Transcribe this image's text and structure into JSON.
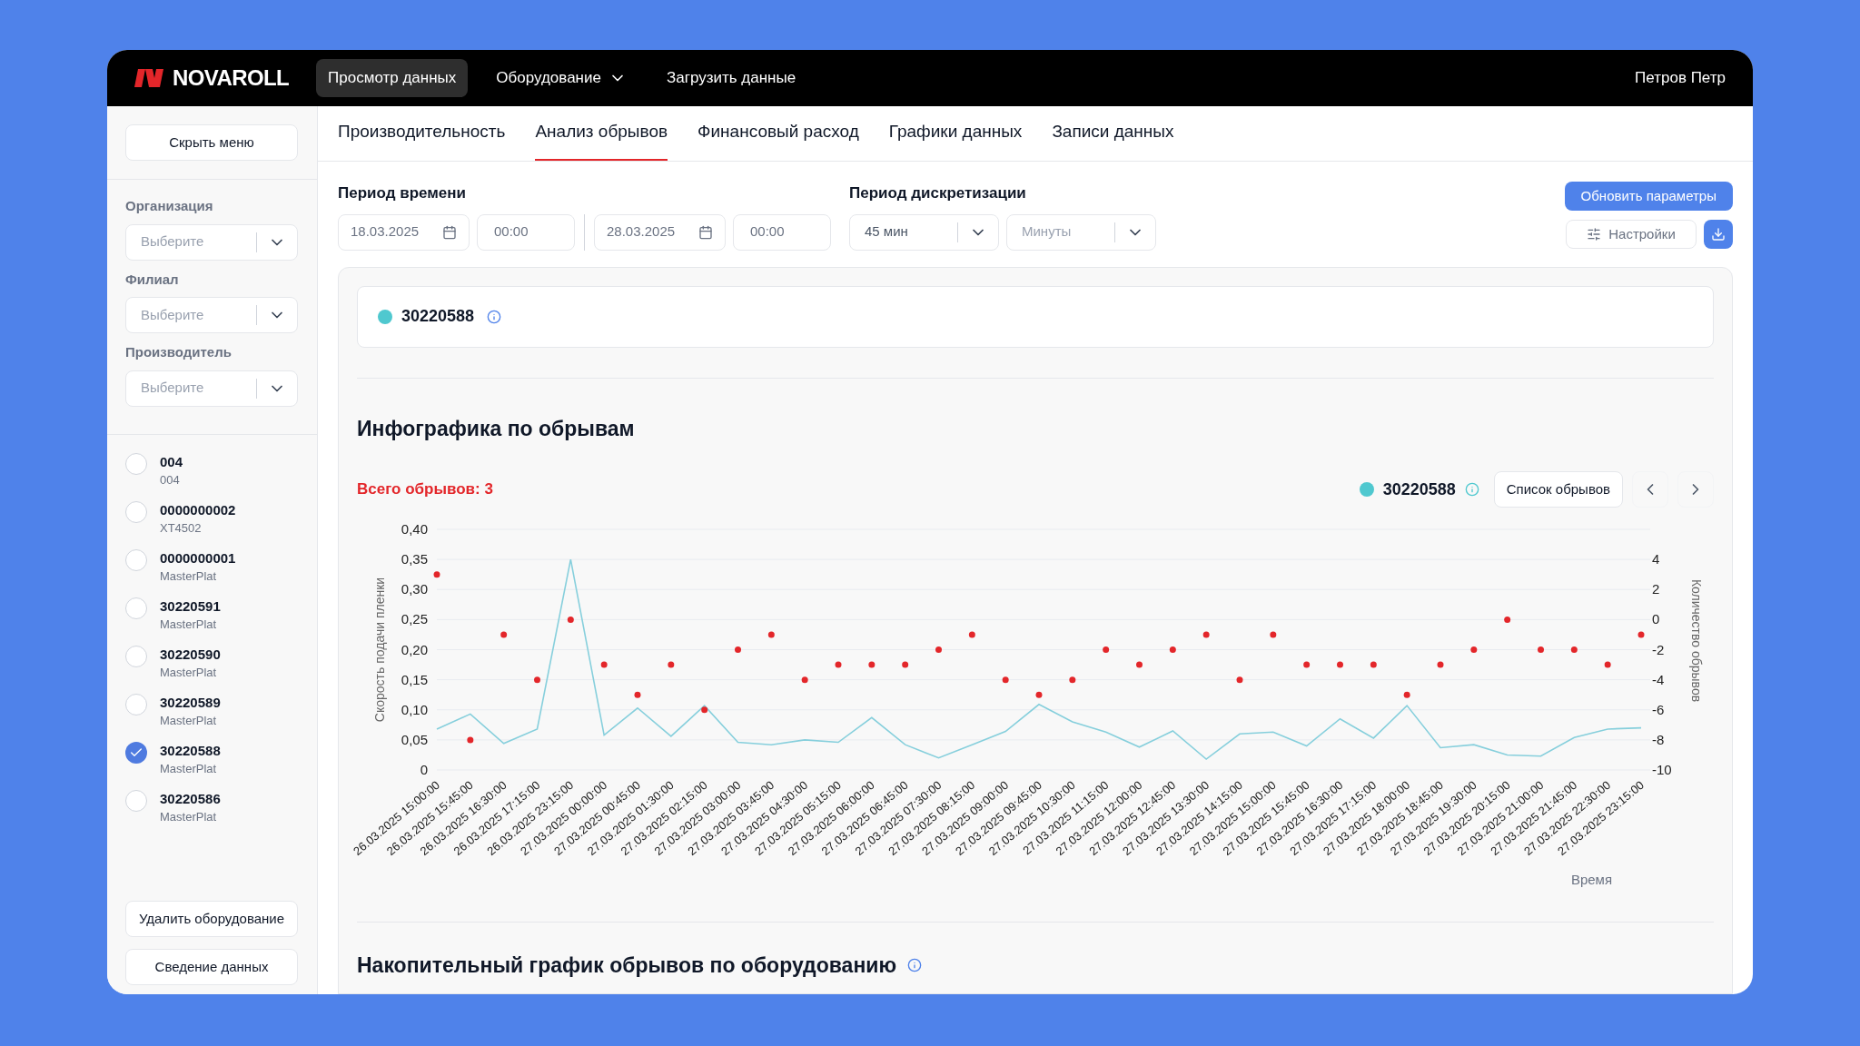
{
  "brand": {
    "name": "NOVAROLL"
  },
  "nav": [
    {
      "label": "Просмотр данных",
      "selected": true,
      "kind": "link"
    },
    {
      "label": "Оборудование",
      "selected": false,
      "kind": "dropdown"
    },
    {
      "label": "Загрузить данные",
      "selected": false,
      "kind": "link"
    }
  ],
  "user": "Петров Петр",
  "sidebar": {
    "hide_button": "Скрыть меню",
    "filters": [
      {
        "label": "Организация",
        "placeholder": "Выберите"
      },
      {
        "label": "Филиал",
        "placeholder": "Выберите"
      },
      {
        "label": "Производитель",
        "placeholder": "Выберите"
      }
    ],
    "equipment": [
      {
        "name": "004",
        "model": "004",
        "checked": false
      },
      {
        "name": "0000000002",
        "model": "XT4502",
        "checked": false
      },
      {
        "name": "0000000001",
        "model": "MasterPlat",
        "checked": false
      },
      {
        "name": "30220591",
        "model": "MasterPlat",
        "checked": false
      },
      {
        "name": "30220590",
        "model": "MasterPlat",
        "checked": false
      },
      {
        "name": "30220589",
        "model": "MasterPlat",
        "checked": false
      },
      {
        "name": "30220588",
        "model": "MasterPlat",
        "checked": true
      },
      {
        "name": "30220586",
        "model": "MasterPlat",
        "checked": false
      }
    ],
    "actions": [
      "Удалить оборудование",
      "Сведение данных"
    ]
  },
  "tabs": [
    {
      "label": "Производительность",
      "selected": false
    },
    {
      "label": "Анализ обрывов",
      "selected": true
    },
    {
      "label": "Финансовый расход",
      "selected": false
    },
    {
      "label": "Графики данных",
      "selected": false
    },
    {
      "label": "Записи данных",
      "selected": false
    }
  ],
  "time_period": {
    "label": "Период времени",
    "from_date": "18.03.2025",
    "from_time": "00:00",
    "to_date": "28.03.2025",
    "to_time": "00:00"
  },
  "discretization": {
    "label": "Период дискретизации",
    "value": "45 мин",
    "unit_placeholder": "Минуты"
  },
  "actions": {
    "update": "Обновить параметры",
    "settings": "Настройки"
  },
  "selected_equipment": [
    {
      "name": "30220588",
      "color": "#4fc8cf"
    }
  ],
  "infographic": {
    "title": "Инфографика по обрывам",
    "total": "Всего обрывов: 3",
    "legend": [
      {
        "name": "30220588",
        "color": "#4fc8cf"
      }
    ],
    "list_button": "Список обрывов",
    "chart_data": {
      "type": "line",
      "xlabel": "Время",
      "ylabel": "Скорость подачи пленки",
      "y2label": "Количество обрывов",
      "categories": [
        "26.03.2025 15:00:00",
        "26.03.2025 15:45:00",
        "26.03.2025 16:30:00",
        "26.03.2025 17:15:00",
        "26.03.2025 23:15:00",
        "27.03.2025 00:00:00",
        "27.03.2025 00:45:00",
        "27.03.2025 01:30:00",
        "27.03.2025 02:15:00",
        "27.03.2025 03:00:00",
        "27.03.2025 03:45:00",
        "27.03.2025 04:30:00",
        "27.03.2025 05:15:00",
        "27.03.2025 06:00:00",
        "27.03.2025 06:45:00",
        "27.03.2025 07:30:00",
        "27.03.2025 08:15:00",
        "27.03.2025 09:00:00",
        "27.03.2025 09:45:00",
        "27.03.2025 10:30:00",
        "27.03.2025 11:15:00",
        "27.03.2025 12:00:00",
        "27.03.2025 12:45:00",
        "27.03.2025 13:30:00",
        "27.03.2025 14:15:00",
        "27.03.2025 15:00:00",
        "27.03.2025 15:45:00",
        "27.03.2025 16:30:00",
        "27.03.2025 17:15:00",
        "27.03.2025 18:00:00",
        "27.03.2025 18:45:00",
        "27.03.2025 19:30:00",
        "27.03.2025 20:15:00",
        "27.03.2025 21:00:00",
        "27.03.2025 21:45:00",
        "27.03.2025 22:30:00",
        "27.03.2025 23:15:00"
      ],
      "ylim": [
        0,
        0.4
      ],
      "yticks": [
        {
          "value": 0,
          "label": "0"
        },
        {
          "value": 0.05,
          "label": "0,05"
        },
        {
          "value": 0.1,
          "label": "0,10"
        },
        {
          "value": 0.15,
          "label": "0,15"
        },
        {
          "value": 0.2,
          "label": "0,20"
        },
        {
          "value": 0.25,
          "label": "0,25"
        },
        {
          "value": 0.3,
          "label": "0,30"
        },
        {
          "value": 0.35,
          "label": "0,35"
        },
        {
          "value": 0.4,
          "label": "0,40"
        }
      ],
      "y2lim": [
        -10,
        6
      ],
      "grid": true,
      "y2ticks": [
        -10,
        -8,
        -6,
        -4,
        -2,
        0,
        2,
        4
      ],
      "series": [
        {
          "color": "#86cfdc",
          "values": [
            0.068,
            0.093,
            0.044,
            0.068,
            0.35,
            0.058,
            0.103,
            0.056,
            0.107,
            0.046,
            0.042,
            0.05,
            0.046,
            0.087,
            0.042,
            0.02,
            0.042,
            0.064,
            0.109,
            0.08,
            0.063,
            0.038,
            0.065,
            0.018,
            0.06,
            0.063,
            0.04,
            0.085,
            0.053,
            0.107,
            0.037,
            0.042,
            0.025,
            0.023,
            0.054,
            0.068,
            0.07
          ]
        },
        {
          "type": "scatter",
          "axis": "y2",
          "color": "#e3262a",
          "values": [
            3,
            -8,
            -1,
            -4,
            0,
            -3,
            -5,
            -3,
            -6,
            -2,
            -1,
            -4,
            -3,
            -3,
            -3,
            -2,
            -1,
            -4,
            -5,
            -4,
            -2,
            -3,
            -2,
            -1,
            -4,
            -1,
            -3,
            -3,
            -3,
            -5,
            -3,
            -2,
            0,
            -2,
            -2,
            -3,
            -1
          ]
        }
      ]
    }
  },
  "cumulative": {
    "title": "Накопительный график обрывов по оборудованию"
  }
}
